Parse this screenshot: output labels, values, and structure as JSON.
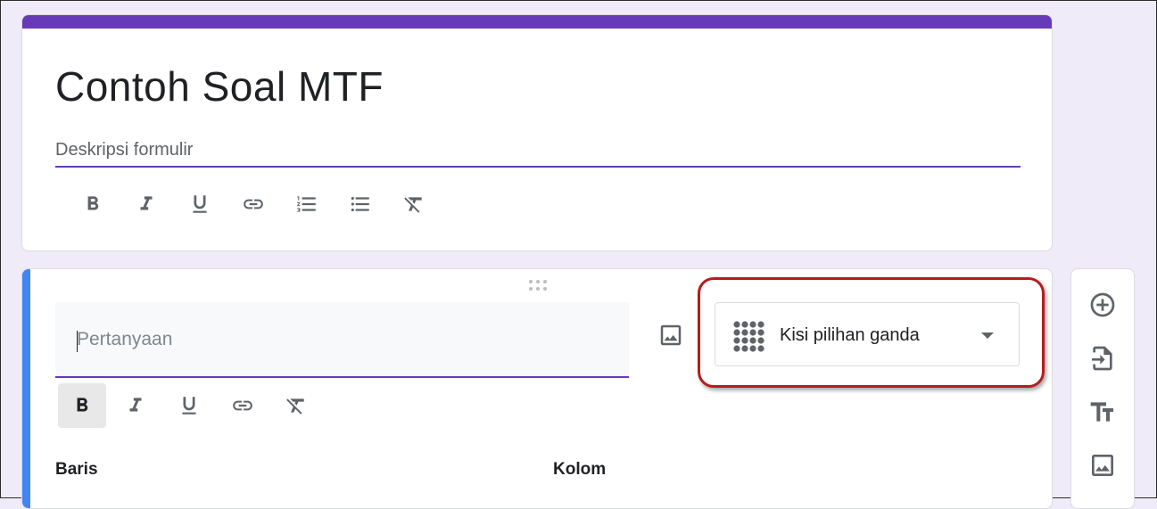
{
  "form": {
    "title": "Contoh Soal MTF",
    "description_placeholder": "Deskripsi formulir"
  },
  "description_toolbar": [
    "bold-icon",
    "italic-icon",
    "underline-icon",
    "link-icon",
    "numbered-list-icon",
    "bulleted-list-icon",
    "clear-format-icon"
  ],
  "question": {
    "placeholder": "Pertanyaan",
    "type_label": "Kisi pilihan ganda",
    "rows_label": "Baris",
    "columns_label": "Kolom"
  },
  "question_toolbar": [
    "bold-icon",
    "italic-icon",
    "underline-icon",
    "link-icon",
    "clear-format-icon"
  ],
  "side_tools": [
    "add-question-icon",
    "import-questions-icon",
    "add-title-icon",
    "add-image-icon"
  ],
  "colors": {
    "accent": "#673ab7",
    "background": "#f0ebf8",
    "active_bar": "#4285f4",
    "highlight": "#b71c1c"
  }
}
